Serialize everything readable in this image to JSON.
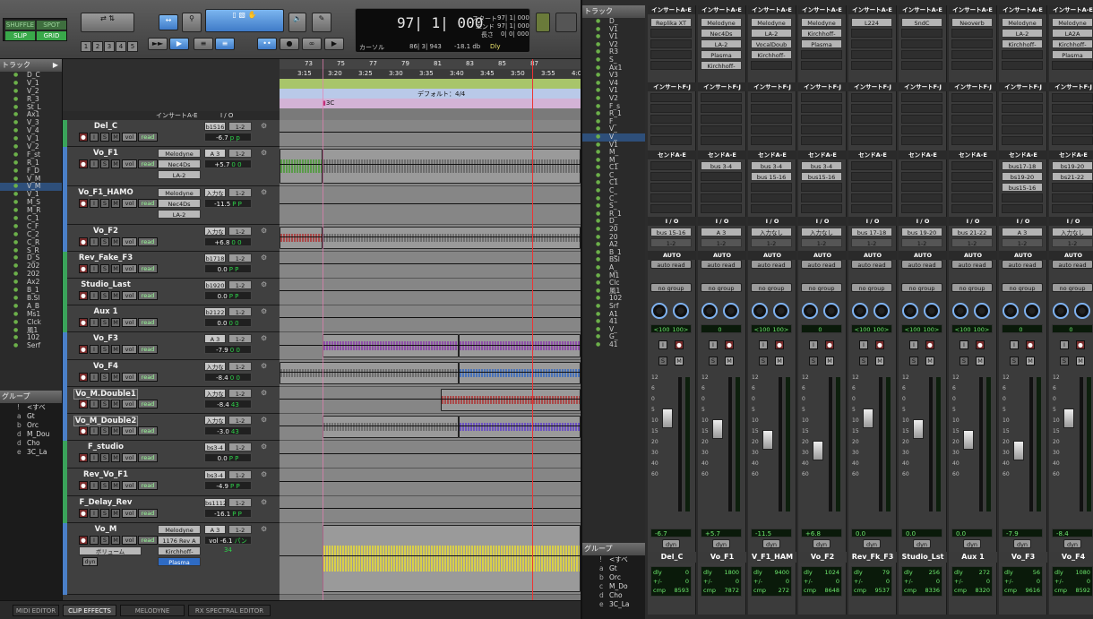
{
  "toolbar": {
    "modes": {
      "shuffle": "SHUFFLE",
      "spot": "SPOT",
      "slip": "SLIP",
      "grid": "GRID"
    },
    "numbers": [
      "1",
      "2",
      "3",
      "4",
      "5"
    ],
    "counter": {
      "main": "97| 1| 000",
      "start_label": "スタート",
      "end_label": "エンド",
      "length_label": "長さ",
      "start": "97| 1| 000",
      "end": "97| 1| 000",
      "length": "0| 0| 000",
      "cursor_label": "カーソル",
      "cursor": "86| 3| 943",
      "db": "-18.1 db",
      "dly": "Dly"
    }
  },
  "tracks_panel": {
    "title": "トラック",
    "items": [
      "D_C",
      "V_1",
      "V_2",
      "R_3",
      "St_L",
      "Ax1",
      "V_3",
      "V_4",
      "V_1",
      "V_2",
      "F_st",
      "R_1",
      "F_D",
      "V_M",
      "V_M",
      "V_1",
      "M_S",
      "M_R",
      "C_1",
      "C_F",
      "C_2",
      "C_R",
      "S_R",
      "D_S",
      "202",
      "202",
      "Ax2",
      "B_1",
      "B.Sl",
      "A_B",
      "Ms1",
      "Clck",
      "風1",
      "102",
      "Serf"
    ]
  },
  "groups_panel": {
    "title": "グループ",
    "items": [
      {
        "k": "!",
        "v": "<すべ"
      },
      {
        "k": "a",
        "v": "Gt"
      },
      {
        "k": "b",
        "v": "Orc"
      },
      {
        "k": "d",
        "v": "M_Dou"
      },
      {
        "k": "d",
        "v": "Cho"
      },
      {
        "k": "e",
        "v": "3C_La"
      }
    ]
  },
  "edit": {
    "col_insert": "インサートA-E",
    "col_io": "I / O",
    "tracks": [
      {
        "name": "Del_C",
        "plugs": [],
        "io": "b1516",
        "io2": "1-2",
        "vol": "-6.7",
        "pan": "p  p"
      },
      {
        "name": "Vo_F1",
        "plugs": [
          "Melodyne",
          "Nec4Ds",
          "LA-2"
        ],
        "io": "A 3",
        "io2": "1-2",
        "vol": "+5.7",
        "pan": "0  0"
      },
      {
        "name": "Vo_F1_HAMO",
        "plugs": [
          "Melodyne",
          "Nec4Ds",
          "LA-2"
        ],
        "io": "入力なし",
        "io2": "1-2",
        "vol": "-11.5",
        "pan": "P  P"
      },
      {
        "name": "Vo_F2",
        "plugs": [],
        "io": "入力なし",
        "io2": "1-2",
        "vol": "+6.8",
        "pan": "0  0"
      },
      {
        "name": "Rev_Fake_F3",
        "plugs": [],
        "io": "b1718",
        "io2": "1-2",
        "vol": "0.0",
        "pan": "P  P"
      },
      {
        "name": "Studio_Last",
        "plugs": [],
        "io": "b1920",
        "io2": "1-2",
        "vol": "0.0",
        "pan": "P  P"
      },
      {
        "name": "Aux 1",
        "plugs": [],
        "io": "b2122",
        "io2": "1-2",
        "vol": "0.0",
        "pan": "0  0"
      },
      {
        "name": "Vo_F3",
        "plugs": [],
        "io": "A 3",
        "io2": "1-2",
        "vol": "-7.9",
        "pan": "0  0"
      },
      {
        "name": "Vo_F4",
        "plugs": [],
        "io": "入力なし",
        "io2": "1-2",
        "vol": "-8.4",
        "pan": "0  0"
      },
      {
        "name": "Vo_M.Double1",
        "plugs": [],
        "io": "入力なし",
        "io2": "1-2",
        "vol": "-8.4",
        "pan": "43"
      },
      {
        "name": "Vo_M_Double2",
        "plugs": [],
        "io": "入力なし",
        "io2": "1-2",
        "vol": "-3.0",
        "pan": "43"
      },
      {
        "name": "F_studio",
        "plugs": [],
        "io": "bs3-4",
        "io2": "1-2",
        "vol": "0.0",
        "pan": "P  P"
      },
      {
        "name": "Rev_Vo_F1",
        "plugs": [],
        "io": "bs3-4",
        "io2": "1-2",
        "vol": "-4.9",
        "pan": "P  P"
      },
      {
        "name": "F_Delay_Rev",
        "plugs": [],
        "io": "bs1112",
        "io2": "1-2",
        "vol": "-16.1",
        "pan": "P  P"
      },
      {
        "name": "Vo_M",
        "plugs": [
          "Melodyne",
          "1176 Rev A",
          "Kirchhoff-",
          "Plasma"
        ],
        "io": "A 3",
        "io2": "1-2",
        "vol": "vol  -6.1",
        "pan": "パン  34"
      }
    ],
    "btn": {
      "vol": "vol",
      "read": "read",
      "dyn": "dyn",
      "volume_label": "ボリューム"
    }
  },
  "timeline": {
    "bars": [
      "73",
      "75",
      "77",
      "79",
      "81",
      "83",
      "85",
      "87"
    ],
    "times": [
      "3:15",
      "3:20",
      "3:25",
      "3:30",
      "3:35",
      "3:40",
      "3:45",
      "3:50",
      "3:55",
      "4:00"
    ],
    "ruler_labels": [
      "小節 | 拍",
      "分:秒",
      "テンポ",
      "拍子",
      "マーカー"
    ],
    "meter": "デフォルト：4/4",
    "marker": "3C"
  },
  "mixer": {
    "tracks_title": "トラック",
    "track_list": [
      "D_",
      "V1",
      "V1",
      "V2",
      "R3",
      "S_",
      "Ax1",
      "V3",
      "V4",
      "V1",
      "V2",
      "F_s",
      "R_1",
      "F_",
      "V_",
      "V_",
      "V1",
      "M_",
      "M_",
      "C1",
      "C_",
      "C1",
      "C_",
      "C_",
      "S_",
      "R_1",
      "D_",
      "20",
      "20",
      "A2",
      "B_1",
      "BSl",
      "A_",
      "M1",
      "Clc",
      "風1",
      "102",
      "Srf",
      "A1",
      "41",
      "V_",
      "G_",
      "41"
    ],
    "groups_title": "グループ",
    "groups": [
      {
        "k": "!",
        "v": "<すべ"
      },
      {
        "k": "a",
        "v": "Gt"
      },
      {
        "k": "b",
        "v": "Orc"
      },
      {
        "k": "c",
        "v": "M_Do"
      },
      {
        "k": "d",
        "v": "Cho"
      },
      {
        "k": "e",
        "v": "3C_La"
      }
    ],
    "labels": {
      "ins_ae": "インサートA-E",
      "ins_fj": "インサートF-J",
      "send_ae": "センドA-E",
      "io": "I / O",
      "auto": "AUTO",
      "auto_read": "auto read",
      "no_group": "no group",
      "pan": "パン",
      "dyn": "dyn",
      "dly": "dly",
      "plusminus": "+/-",
      "cmp": "cmp"
    },
    "strips": [
      {
        "name": "Del_C",
        "ins": [
          "Replika XT"
        ],
        "sends": [],
        "in": "bus 15-16",
        "out": "1-2",
        "pan_l": "<100",
        "pan_r": "100>",
        "vol": "-6.7",
        "dly": "0",
        "pm": "0",
        "cmp": "8593"
      },
      {
        "name": "Vo_F1",
        "ins": [
          "Melodyne",
          "Nec4Ds",
          "LA-2",
          "Plasma",
          "Kirchhoff-"
        ],
        "sends": [
          "bus 3-4"
        ],
        "in": "A 3",
        "out": "1-2",
        "pan_l": "0",
        "pan_r": "",
        "vol": "+5.7",
        "dly": "1800",
        "pm": "0",
        "cmp": "7872"
      },
      {
        "name": "V_F1_HAM",
        "ins": [
          "Melodyne",
          "LA-2",
          "VocalDoub",
          "Kirchhoff-"
        ],
        "sends": [
          "bus 3-4",
          "bus 15-16"
        ],
        "in": "入力なし",
        "out": "1-2",
        "pan_l": "<100",
        "pan_r": "100>",
        "vol": "-11.5",
        "dly": "9400",
        "pm": "0",
        "cmp": "272"
      },
      {
        "name": "Vo_F2",
        "ins": [
          "Melodyne",
          "Kirchhoff-",
          "Plasma"
        ],
        "sends": [
          "bus 3-4",
          "bus15-16"
        ],
        "in": "入力なし",
        "out": "1-2",
        "pan_l": "0",
        "pan_r": "",
        "vol": "+6.8",
        "dly": "1024",
        "pm": "0",
        "cmp": "8648"
      },
      {
        "name": "Rev_Fk_F3",
        "ins": [
          "L224"
        ],
        "sends": [],
        "in": "bus 17-18",
        "out": "1-2",
        "pan_l": "<100",
        "pan_r": "100>",
        "vol": "0.0",
        "dly": "79",
        "pm": "0",
        "cmp": "9537"
      },
      {
        "name": "Studio_Lst",
        "ins": [
          "SndC"
        ],
        "sends": [],
        "in": "bus 19-20",
        "out": "1-2",
        "pan_l": "<100",
        "pan_r": "100>",
        "vol": "0.0",
        "dly": "256",
        "pm": "0",
        "cmp": "8336"
      },
      {
        "name": "Aux 1",
        "ins": [
          "Neoverb"
        ],
        "sends": [],
        "in": "bus 21-22",
        "out": "1-2",
        "pan_l": "<100",
        "pan_r": "100>",
        "vol": "0.0",
        "dly": "272",
        "pm": "0",
        "cmp": "8320"
      },
      {
        "name": "Vo_F3",
        "ins": [
          "Melodyne",
          "LA-2",
          "Kirchhoff-"
        ],
        "sends": [
          "bus17-18",
          "bs19-20",
          "bus15-16"
        ],
        "in": "A 3",
        "out": "1-2",
        "pan_l": "0",
        "pan_r": "",
        "vol": "-7.9",
        "dly": "56",
        "pm": "0",
        "cmp": "9616"
      },
      {
        "name": "Vo_F4",
        "ins": [
          "Melodyne",
          "LA2A",
          "Kirchhoff-",
          "Plasma"
        ],
        "sends": [
          "bs19-20",
          "bs21-22"
        ],
        "in": "入力なし",
        "out": "1-2",
        "pan_l": "0",
        "pan_r": "",
        "vol": "-8.4",
        "vol2": "-131",
        "dly": "1080",
        "pm": "0",
        "cmp": "8592"
      }
    ]
  },
  "bottom_tabs": [
    "MIDI EDITOR",
    "CLIP EFFECTS",
    "MELODYNE",
    "RX SPECTRAL EDITOR"
  ],
  "colors": {
    "accent": "#3f7bc8",
    "green": "#39a84a",
    "clip_purple": "#8e4fa8",
    "clip_blue": "#4a73b8",
    "clip_red": "#a94a4a",
    "clip_green": "#5a9a4a",
    "clip_yellow": "#d9cf4a"
  }
}
